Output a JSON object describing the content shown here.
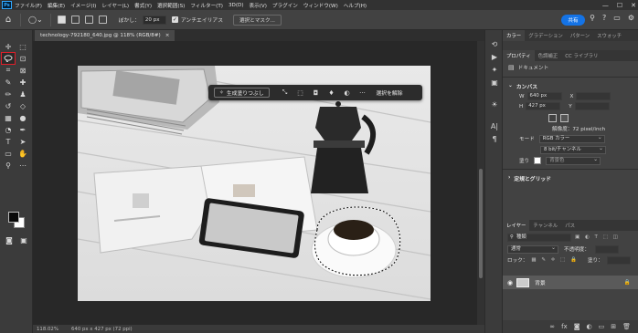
{
  "app": {
    "logo": "Ps"
  },
  "menubar": {
    "items": [
      "ファイル(F)",
      "編集(E)",
      "イメージ(I)",
      "レイヤー(L)",
      "書式(Y)",
      "選択範囲(S)",
      "フィルター(T)",
      "3D(D)",
      "表示(V)",
      "プラグイン",
      "ウィンドウ(W)",
      "ヘルプ(H)"
    ],
    "window_controls": [
      "—",
      "☐",
      "✕"
    ]
  },
  "options": {
    "feather_label": "ぼかし：",
    "feather_value": "20 px",
    "antialias_label": "アンチエイリアス",
    "select_mask_label": "選択とマスク...",
    "share_label": "共有"
  },
  "document": {
    "tab_title": "technology-792180_640.jpg @ 118% (RGB/8#)",
    "tab_close": "×",
    "status_zoom": "118.02%",
    "status_info": "640 px x 427 px (72 ppi)"
  },
  "context_bar": {
    "generative_fill": "生成塗りつぶし",
    "deselect": "選択を解除",
    "more": "···"
  },
  "panel_tabs_top": [
    "カラー",
    "グラデーション",
    "パターン",
    "スウォッチ"
  ],
  "panel_tabs_props": [
    "プロパティ",
    "色調補正",
    "CC ライブラリ"
  ],
  "properties": {
    "doc_type": "ドキュメント",
    "canvas_title": "カンバス",
    "w_label": "W",
    "w_value": "640 px",
    "h_label": "H",
    "h_value": "427 px",
    "x_label": "X",
    "y_label": "Y",
    "resolution": "解像度：72 pixel/inch",
    "mode_label": "モード",
    "mode_value": "RGB カラー",
    "bit_value": "8 bit/チャンネル",
    "fill_label": "塗り",
    "fill_value": "背景色",
    "rulers_title": "定規とグリッド"
  },
  "layers": {
    "tabs": [
      "レイヤー",
      "チャンネル",
      "パス"
    ],
    "search_placeholder": "種類",
    "blend_mode": "通常",
    "opacity_label": "不透明度：",
    "lock_label": "ロック：",
    "fill_label": "塗り：",
    "layer_name": "背景"
  },
  "colors": {
    "accent": "#1473e6",
    "selected_tool_outline": "#e01e2a"
  }
}
